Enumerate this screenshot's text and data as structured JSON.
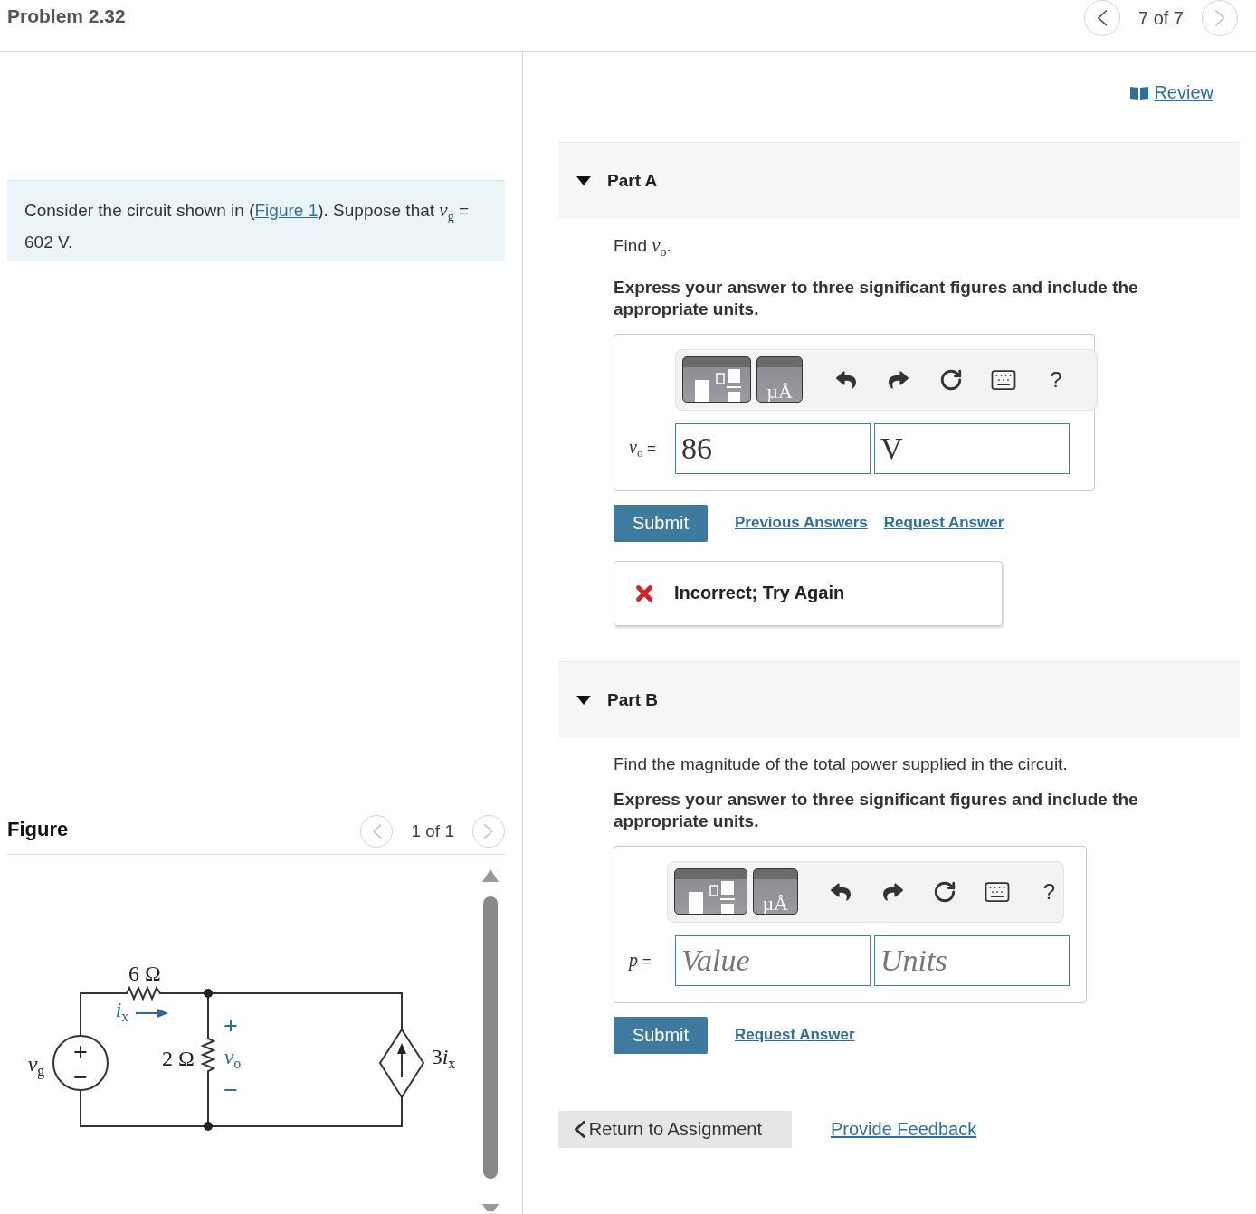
{
  "header": {
    "title": "Problem 2.32",
    "pager": {
      "text": "7 of 7",
      "prev_disabled": false,
      "next_disabled": true
    }
  },
  "review": {
    "label": "Review"
  },
  "statement": {
    "before": "Consider the circuit shown in (",
    "link": "Figure 1",
    "after": "). Suppose that *v*$_{g}$ = 602 V."
  },
  "figure": {
    "title": "Figure",
    "pager": {
      "text": "1 of 1",
      "prev_disabled": true,
      "next_disabled": true
    },
    "labels": [
      {
        "kind": "value",
        "text": "6 Ω",
        "color": "#222222"
      },
      {
        "kind": "value",
        "text": "*i*$_{x}$",
        "color": "#2e6a94"
      },
      {
        "kind": "sign",
        "text": "+",
        "color": "#2e6a94"
      },
      {
        "kind": "value",
        "text": "*v*$_{g}$",
        "color": "#222222"
      },
      {
        "kind": "sign",
        "text": "+",
        "color": "#222222"
      },
      {
        "kind": "value",
        "text": "2 Ω",
        "color": "#222222"
      },
      {
        "kind": "value",
        "text": "*v*$_{o}$",
        "color": "#2e6a94"
      },
      {
        "kind": "value",
        "prefix": "3",
        "text": "*i*$_{x}$",
        "color": "#222222"
      },
      {
        "kind": "sign",
        "text": "−",
        "color": "#222222"
      },
      {
        "kind": "sign",
        "text": "−",
        "color": "#2e6a94"
      }
    ]
  },
  "parts": [
    {
      "title": "Part A",
      "expanded": true,
      "question": "Find *v*$_{o}$.",
      "instruction": "Express your answer to three significant figures and include the appropriate units.",
      "toolbar": {
        "units_glyph": "µÅ",
        "help": "?"
      },
      "answer": {
        "label": "*v*$_{o}$ =",
        "fields": [
          {
            "value": "86"
          },
          {
            "value": "V"
          }
        ]
      },
      "submit": "Submit",
      "links": [
        "Previous Answers",
        "Request Answer"
      ],
      "feedback": {
        "text": "Incorrect; Try Again"
      }
    },
    {
      "title": "Part B",
      "expanded": true,
      "question": "Find the magnitude of the total power supplied in the circuit.",
      "instruction": "Express your answer to three significant figures and include the appropriate units.",
      "toolbar": {
        "units_glyph": "µÅ",
        "help": "?"
      },
      "answer": {
        "label": "*p* =",
        "fields": [
          {
            "placeholder": "Value"
          },
          {
            "placeholder": "Units"
          }
        ]
      },
      "submit": "Submit",
      "links": [
        "Request Answer"
      ]
    }
  ],
  "footer": {
    "return_label": "Return to Assignment",
    "feedback_link": "Provide Feedback"
  }
}
